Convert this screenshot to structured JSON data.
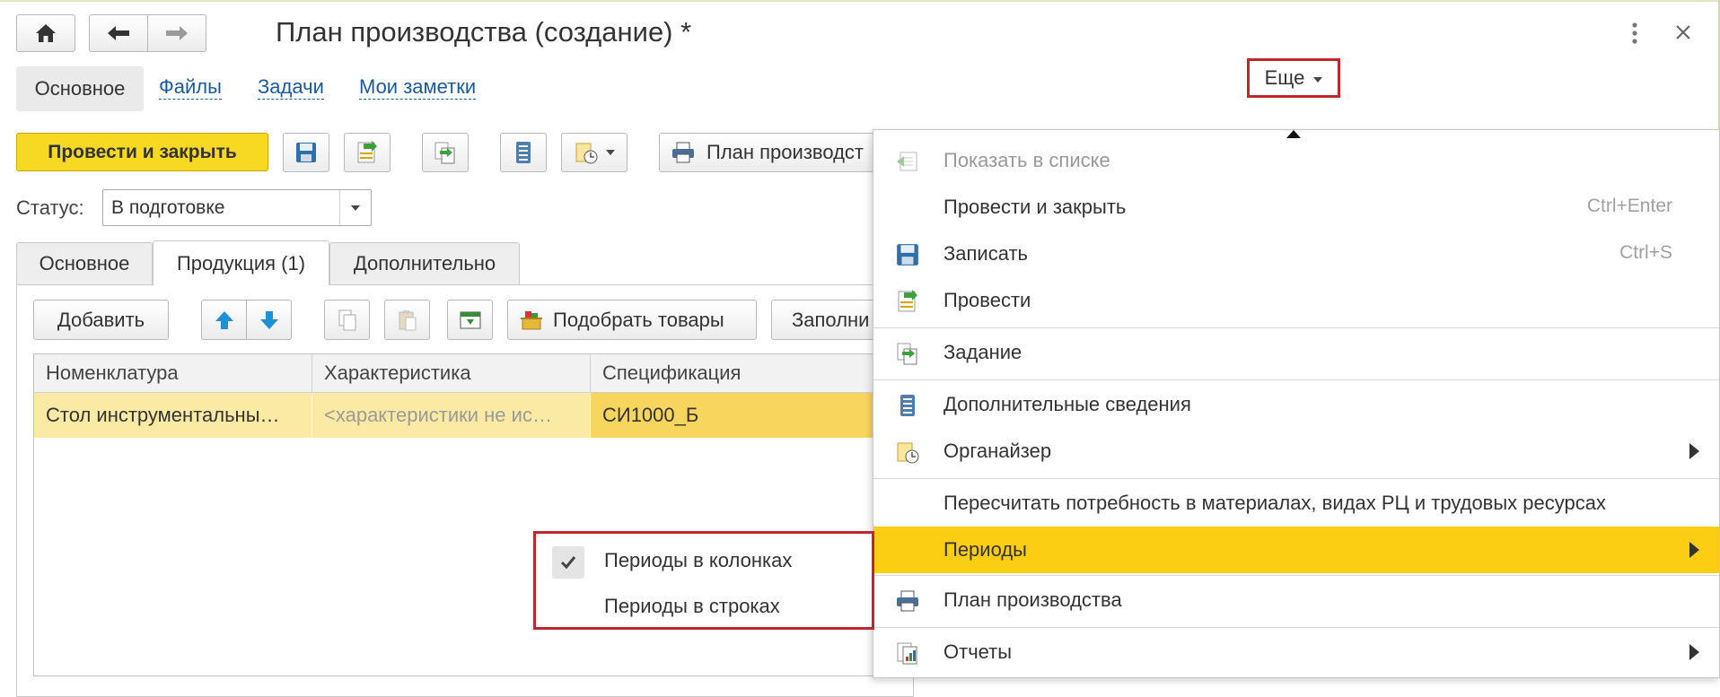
{
  "window": {
    "title": "План производства (создание) *",
    "more_icon": "vertical-dots-icon",
    "close_icon": "close-icon"
  },
  "nav": {
    "home_icon": "home-icon",
    "back_icon": "arrow-left-icon",
    "forward_icon": "arrow-right-icon",
    "tabs": [
      "Основное",
      "Файлы",
      "Задачи",
      "Мои заметки"
    ]
  },
  "more_button": {
    "label": "Еще"
  },
  "toolbar": {
    "post_close_label": "Провести и закрыть",
    "print_label": "План производст"
  },
  "status": {
    "label": "Статус:",
    "value": "В подготовке"
  },
  "doc_tabs": [
    "Основное",
    "Продукция (1)",
    "Дополнительно"
  ],
  "grid_toolbar": {
    "add_label": "Добавить",
    "pick_label": "Подобрать товары",
    "fill_label": "Заполни"
  },
  "grid": {
    "columns": [
      "Номенклатура",
      "Характеристика",
      "Спецификация"
    ],
    "rows": [
      [
        "Стол инструментальны…",
        "<характеристики не ис…",
        "СИ1000_Б"
      ]
    ]
  },
  "menu": {
    "items": [
      {
        "label": "Показать в списке",
        "icon": "show-in-list-icon",
        "disabled": true
      },
      {
        "label": "Провести и закрыть",
        "shortcut": "Ctrl+Enter"
      },
      {
        "label": "Записать",
        "icon": "save-icon",
        "shortcut": "Ctrl+S"
      },
      {
        "label": "Провести",
        "icon": "post-icon"
      },
      {
        "label": "Задание",
        "icon": "task-icon"
      },
      {
        "label": "Дополнительные сведения",
        "icon": "additional-info-icon"
      },
      {
        "label": "Органайзер",
        "icon": "organizer-icon",
        "submenu": true
      },
      {
        "label": "Пересчитать потребность в материалах, видах РЦ и трудовых ресурсах"
      },
      {
        "label": "Периоды",
        "submenu": true,
        "highlighted": true
      },
      {
        "label": "План производства",
        "icon": "printer-icon"
      },
      {
        "label": "Отчеты",
        "icon": "reports-icon",
        "submenu": true
      }
    ]
  },
  "submenu": {
    "items": [
      {
        "label": "Периоды в колонках",
        "checked": true
      },
      {
        "label": "Периоды в строках",
        "checked": false
      }
    ]
  },
  "colors": {
    "accent_yellow": "#f7d823",
    "menu_highlight": "#fbcd13",
    "highlight_border": "#c0262d",
    "row_selected": "#fbeaa4",
    "link_blue": "#1a5a9c"
  }
}
